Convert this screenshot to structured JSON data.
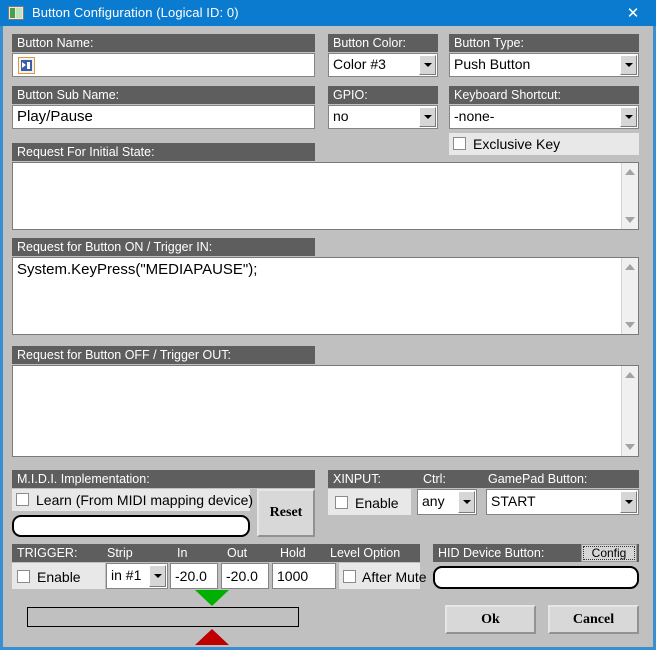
{
  "window": {
    "title": "Button Configuration (Logical ID: 0)",
    "close_label": "✕",
    "icon": "window-icon",
    "titlebar_color": "#0a7bce"
  },
  "button_name": {
    "header": "Button Name:",
    "value": "",
    "icon": "media-play-pause-icon"
  },
  "button_color": {
    "header": "Button Color:",
    "value": "Color #3"
  },
  "button_type": {
    "header": "Button Type:",
    "value": "Push Button"
  },
  "button_sub_name": {
    "header": "Button Sub Name:",
    "value": "Play/Pause"
  },
  "gpio": {
    "header": "GPIO:",
    "value": "no"
  },
  "keyboard_shortcut": {
    "header": "Keyboard Shortcut:",
    "value": "-none-",
    "exclusive_key_label": "Exclusive Key",
    "exclusive_key_checked": false
  },
  "initial_state": {
    "header": "Request For Initial State:",
    "value": ""
  },
  "button_on": {
    "header": "Request for Button ON / Trigger IN:",
    "value": "System.KeyPress(\"MEDIAPAUSE\");"
  },
  "button_off": {
    "header": "Request for Button OFF / Trigger OUT:",
    "value": ""
  },
  "midi": {
    "header": "M.I.D.I. Implementation:",
    "learn_label": "Learn (From MIDI mapping device)",
    "learn_checked": false,
    "mapping_value": "",
    "reset_label": "Reset"
  },
  "xinput": {
    "header": "XINPUT:",
    "ctrl_header": "Ctrl:",
    "gamepad_header": "GamePad Button:",
    "enable_label": "Enable",
    "enable_checked": false,
    "ctrl_value": "any",
    "gamepad_value": "START"
  },
  "trigger": {
    "header": "TRIGGER:",
    "strip_header": "Strip",
    "in_header": "In",
    "out_header": "Out",
    "hold_header": "Hold",
    "level_option_header": "Level Option",
    "enable_label": "Enable",
    "enable_checked": false,
    "strip_value": "in #1",
    "in_value": "-20.0",
    "out_value": "-20.0",
    "hold_value": "1000",
    "after_mute_label": "After Mute",
    "after_mute_checked": false,
    "marker_in_color": "#00b000",
    "marker_out_color": "#c00000"
  },
  "hid": {
    "header": "HID Device Button:",
    "config_label": "Config",
    "value": ""
  },
  "actions": {
    "ok_label": "Ok",
    "cancel_label": "Cancel"
  }
}
